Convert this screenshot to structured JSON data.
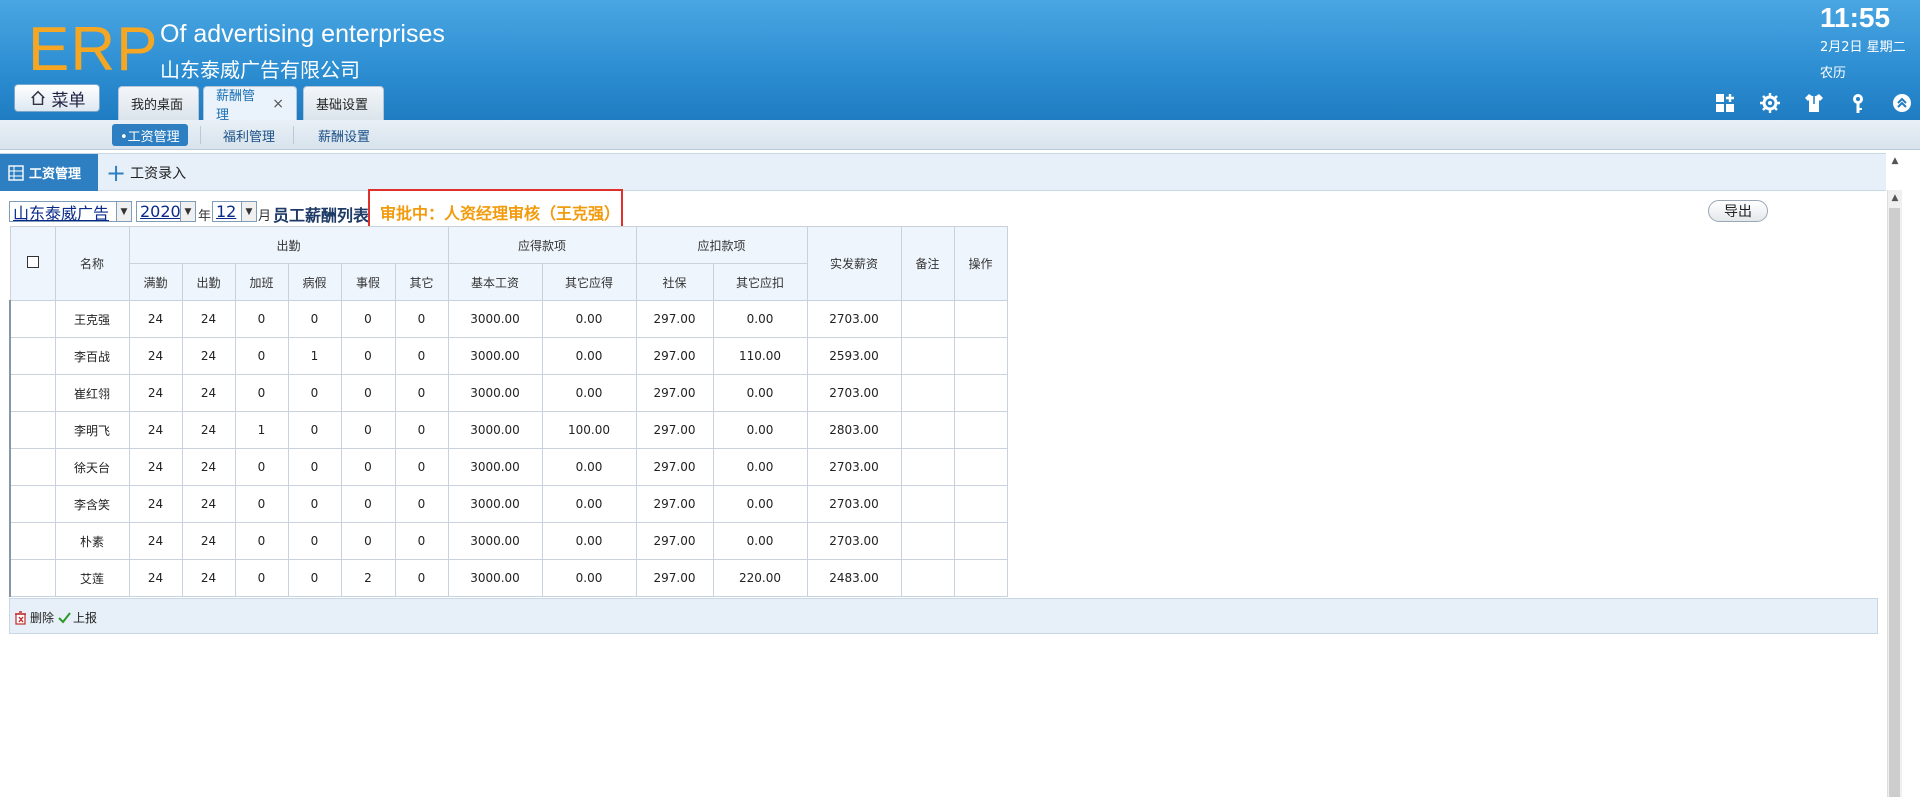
{
  "header": {
    "logo": "ERP",
    "app_name_en": "Of advertising enterprises",
    "company_name": "山东泰威广告有限公司",
    "clock": "11:55",
    "date": "2月2日 星期二",
    "lunar": "农历",
    "menu_label": "菜单",
    "tabs": [
      {
        "label": "我的桌面",
        "active": false
      },
      {
        "label": "薪酬管理",
        "active": true,
        "close": "×"
      },
      {
        "label": "基础设置",
        "active": false
      }
    ],
    "icons": [
      "apps-add-icon",
      "gear-icon",
      "shirt-icon",
      "key-icon",
      "collapse-icon"
    ]
  },
  "subnav": {
    "items": [
      {
        "label": "•工资管理",
        "active": true
      },
      {
        "label": "福利管理",
        "active": false
      },
      {
        "label": "薪酬设置",
        "active": false
      }
    ]
  },
  "toolbar": {
    "salary_mgmt": "工资管理",
    "salary_entry": "工资录入"
  },
  "filter": {
    "company": "山东泰威广告",
    "year": "2020",
    "year_label": "年",
    "month": "12",
    "month_label": "月",
    "list_title": "员工薪酬列表",
    "status": "审批中：人资经理审核（王克强）",
    "export_label": "导出"
  },
  "table": {
    "headers": {
      "name": "名称",
      "attendance": "出勤",
      "payable": "应得款项",
      "deductions": "应扣款项",
      "net_pay": "实发薪资",
      "remark": "备注",
      "action": "操作",
      "sub": [
        "满勤",
        "出勤",
        "加班",
        "病假",
        "事假",
        "其它",
        "基本工资",
        "其它应得",
        "社保",
        "其它应扣"
      ]
    },
    "rows": [
      {
        "name": "王克强",
        "full": "24",
        "att": "24",
        "ot": "0",
        "sick": "0",
        "personal": "0",
        "other": "0",
        "base": "3000.00",
        "other_earn": "0.00",
        "social": "297.00",
        "other_ded": "0.00",
        "net": "2703.00"
      },
      {
        "name": "李百战",
        "full": "24",
        "att": "24",
        "ot": "0",
        "sick": "1",
        "personal": "0",
        "other": "0",
        "base": "3000.00",
        "other_earn": "0.00",
        "social": "297.00",
        "other_ded": "110.00",
        "net": "2593.00"
      },
      {
        "name": "崔红翎",
        "full": "24",
        "att": "24",
        "ot": "0",
        "sick": "0",
        "personal": "0",
        "other": "0",
        "base": "3000.00",
        "other_earn": "0.00",
        "social": "297.00",
        "other_ded": "0.00",
        "net": "2703.00"
      },
      {
        "name": "李明飞",
        "full": "24",
        "att": "24",
        "ot": "1",
        "sick": "0",
        "personal": "0",
        "other": "0",
        "base": "3000.00",
        "other_earn": "100.00",
        "social": "297.00",
        "other_ded": "0.00",
        "net": "2803.00"
      },
      {
        "name": "徐天台",
        "full": "24",
        "att": "24",
        "ot": "0",
        "sick": "0",
        "personal": "0",
        "other": "0",
        "base": "3000.00",
        "other_earn": "0.00",
        "social": "297.00",
        "other_ded": "0.00",
        "net": "2703.00"
      },
      {
        "name": "李含笑",
        "full": "24",
        "att": "24",
        "ot": "0",
        "sick": "0",
        "personal": "0",
        "other": "0",
        "base": "3000.00",
        "other_earn": "0.00",
        "social": "297.00",
        "other_ded": "0.00",
        "net": "2703.00"
      },
      {
        "name": "朴素",
        "full": "24",
        "att": "24",
        "ot": "0",
        "sick": "0",
        "personal": "0",
        "other": "0",
        "base": "3000.00",
        "other_earn": "0.00",
        "social": "297.00",
        "other_ded": "0.00",
        "net": "2703.00"
      },
      {
        "name": "艾莲",
        "full": "24",
        "att": "24",
        "ot": "0",
        "sick": "0",
        "personal": "2",
        "other": "0",
        "base": "3000.00",
        "other_earn": "0.00",
        "social": "297.00",
        "other_ded": "220.00",
        "net": "2483.00"
      }
    ]
  },
  "actions": {
    "delete": "删除",
    "report": "上报"
  },
  "colors": {
    "header_blue": "#2e8fd3",
    "logo_orange": "#f5a623",
    "status_orange": "#f29b0c",
    "highlight_red": "#e0302b"
  }
}
